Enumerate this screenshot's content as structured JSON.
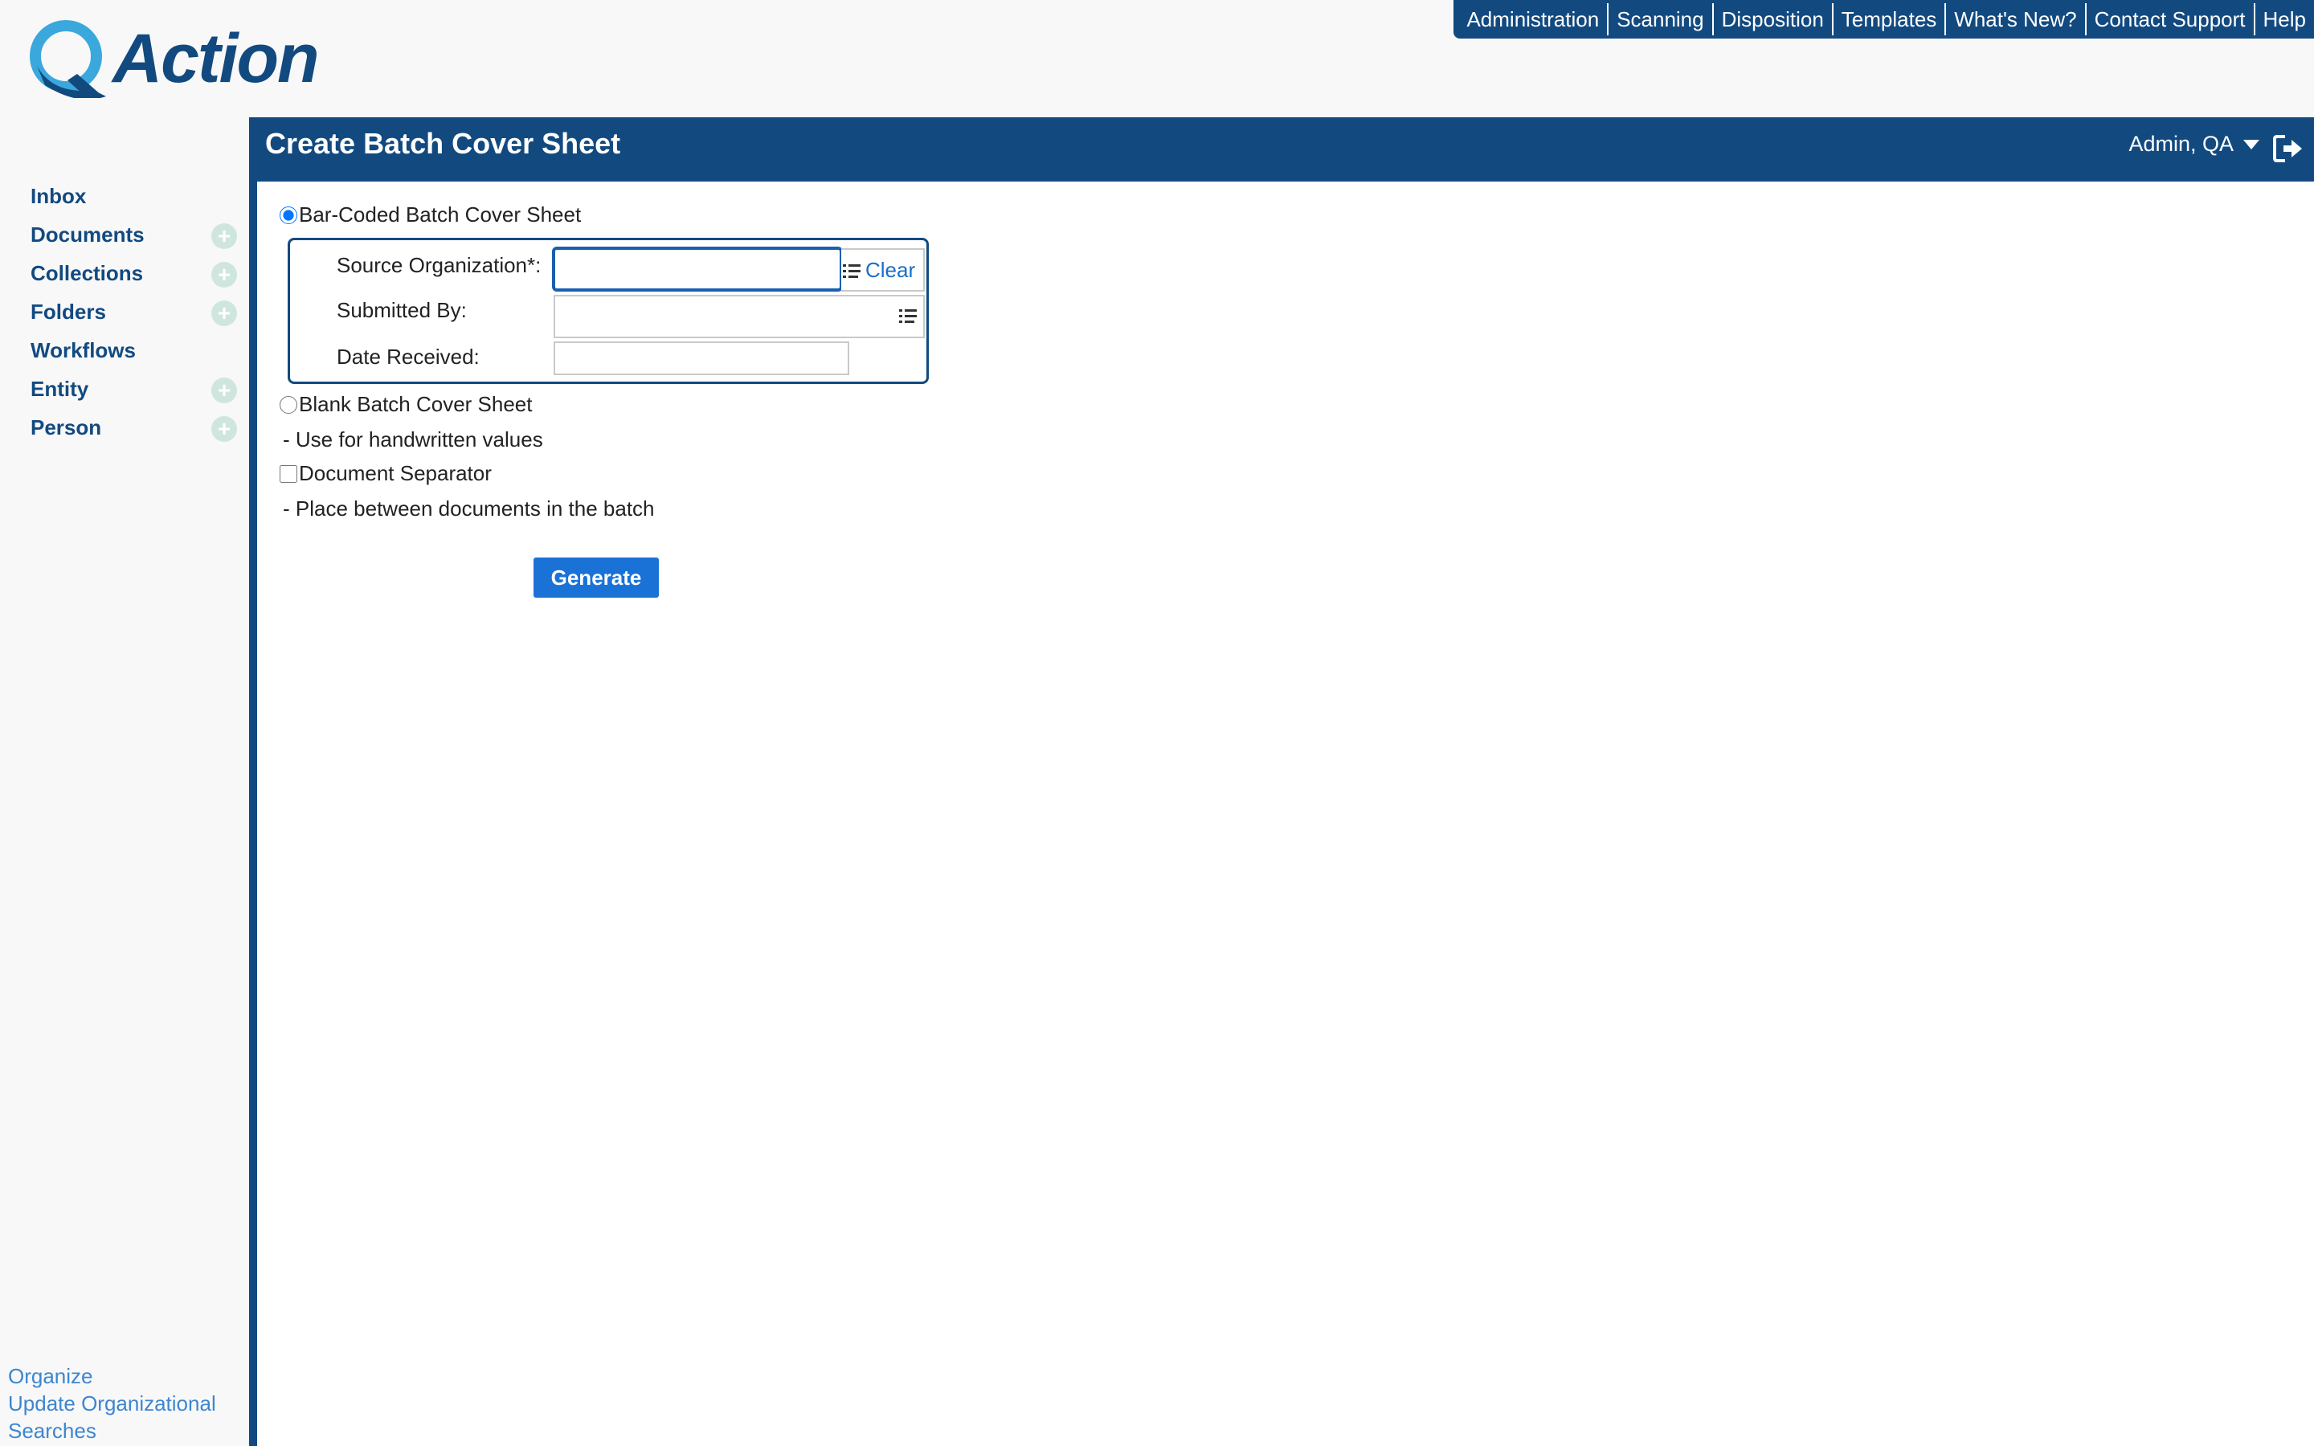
{
  "app": {
    "logo_text": "Action"
  },
  "topnav": [
    {
      "label": "Administration"
    },
    {
      "label": "Scanning"
    },
    {
      "label": "Disposition"
    },
    {
      "label": "Templates"
    },
    {
      "label": "What's New?"
    },
    {
      "label": "Contact Support"
    },
    {
      "label": "Help"
    }
  ],
  "sidebar": {
    "items": [
      {
        "label": "Inbox",
        "has_add": false
      },
      {
        "label": "Documents",
        "has_add": true
      },
      {
        "label": "Collections",
        "has_add": true
      },
      {
        "label": "Folders",
        "has_add": true
      },
      {
        "label": "Workflows",
        "has_add": false
      },
      {
        "label": "Entity",
        "has_add": true
      },
      {
        "label": "Person",
        "has_add": true
      }
    ],
    "add_symbol": "+",
    "bottom_links": [
      "Organize",
      "Update Organizational",
      "Searches"
    ]
  },
  "header": {
    "title": "Create Batch Cover Sheet",
    "user": "Admin, QA"
  },
  "form": {
    "barcoded_label": "Bar-Coded Batch Cover Sheet",
    "barcoded_selected": true,
    "source_org_label": "Source Organization*:",
    "source_org_value": "",
    "clear_label": "Clear",
    "submitted_by_label": "Submitted By:",
    "submitted_by_value": "",
    "date_received_label": "Date Received:",
    "date_received_value": "",
    "blank_label": "Blank Batch Cover Sheet",
    "blank_selected": false,
    "blank_hint": "- Use for handwritten values",
    "separator_label": "Document Separator",
    "separator_checked": false,
    "separator_hint": "- Place between documents in the batch",
    "generate_label": "Generate"
  },
  "colors": {
    "brand": "#124a80",
    "button": "#1a72d6",
    "link": "#3d86d0",
    "add_icon": "#cfe6de"
  }
}
